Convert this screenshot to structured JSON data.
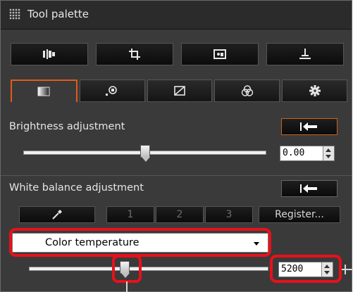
{
  "window": {
    "title": "Tool palette"
  },
  "toolbar": {
    "buttons": [
      {
        "icon": "split-view-icon"
      },
      {
        "icon": "crop-icon"
      },
      {
        "icon": "image-preview-icon"
      },
      {
        "icon": "stamp-icon"
      }
    ]
  },
  "tabs": [
    {
      "icon": "basic-adjust-icon",
      "active": true
    },
    {
      "icon": "zoom-detail-icon"
    },
    {
      "icon": "tone-curve-icon"
    },
    {
      "icon": "color-adjust-icon"
    },
    {
      "icon": "settings-gear-icon"
    }
  ],
  "brightness": {
    "label": "Brightness adjustment",
    "value": "0.00",
    "slider_level": 0.5
  },
  "white_balance": {
    "label": "White balance adjustment",
    "preset_buttons": [
      "1",
      "2",
      "3"
    ],
    "register_label": "Register...",
    "mode": "Color temperature",
    "temperature": "5200",
    "slider_level": 0.4
  },
  "colors": {
    "panel": "#3a3a3a",
    "accent": "#e25a1c",
    "highlight": "#e8101b"
  }
}
